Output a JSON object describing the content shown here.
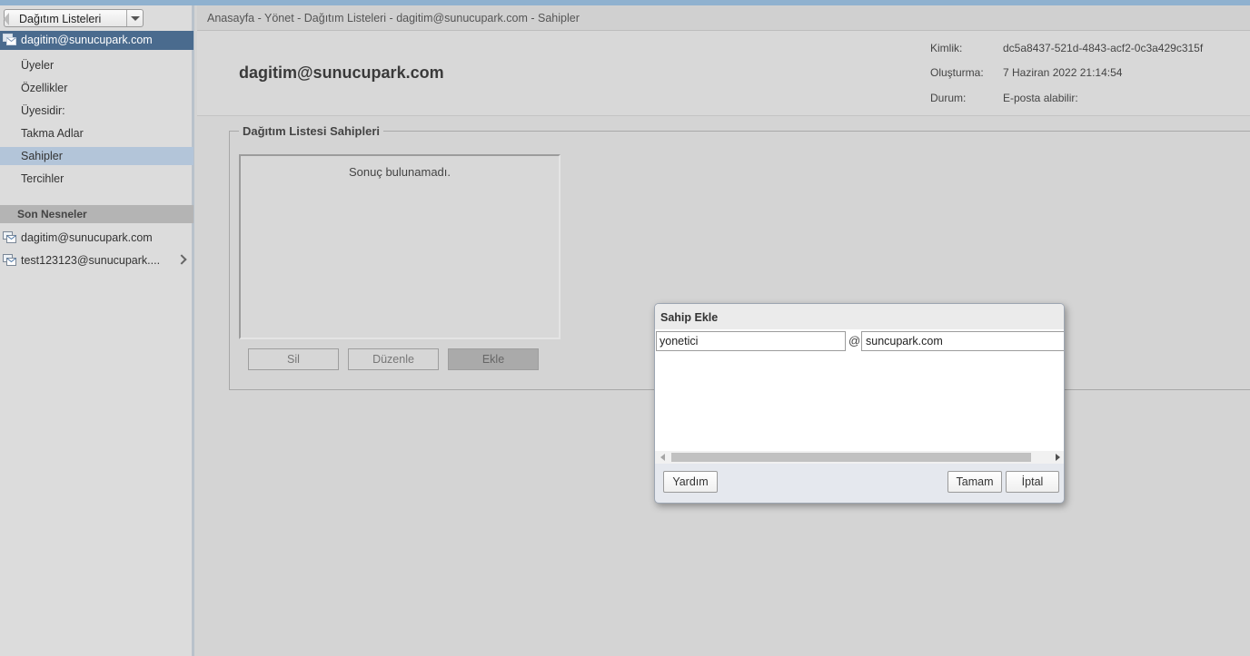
{
  "sidebar": {
    "app_switcher": {
      "label": "Dağıtım Listeleri"
    },
    "selected_account": "dagitim@sunucupark.com",
    "nav_items": [
      {
        "label": "Üyeler"
      },
      {
        "label": "Özellikler"
      },
      {
        "label": "Üyesidir:"
      },
      {
        "label": "Takma Adlar"
      },
      {
        "label": "Sahipler",
        "active": true
      },
      {
        "label": "Tercihler"
      }
    ],
    "recent_header": "Son Nesneler",
    "recent_items": [
      {
        "label": "dagitim@sunucupark.com"
      },
      {
        "label": "test123123@sunucupark...."
      }
    ]
  },
  "breadcrumb": "Anasayfa - Yönet - Dağıtım Listeleri - dagitim@sunucupark.com - Sahipler",
  "header": {
    "title": "dagitim@sunucupark.com",
    "properties": [
      {
        "label": "Kimlik:",
        "value": "dc5a8437-521d-4843-acf2-0c3a429c315f"
      },
      {
        "label": "Oluşturma:",
        "value": "7 Haziran 2022 21:14:54"
      },
      {
        "label": "Durum:",
        "value": "E-posta alabilir:"
      }
    ]
  },
  "owners": {
    "legend": "Dağıtım Listesi Sahipleri",
    "empty_text": "Sonuç bulunamadı.",
    "buttons": {
      "delete": "Sil",
      "edit": "Düzenle",
      "add": "Ekle"
    }
  },
  "dialog": {
    "title": "Sahip Ekle",
    "user_value": "yonetici",
    "at": "@",
    "domain_value": "suncupark.com",
    "buttons": {
      "help": "Yardım",
      "ok": "Tamam",
      "cancel": "İptal"
    }
  },
  "colors": {
    "selected_account_bg": "#4a6b8e",
    "active_nav_bg": "#b3c5d9",
    "top_strip": "#8fb1cf"
  }
}
